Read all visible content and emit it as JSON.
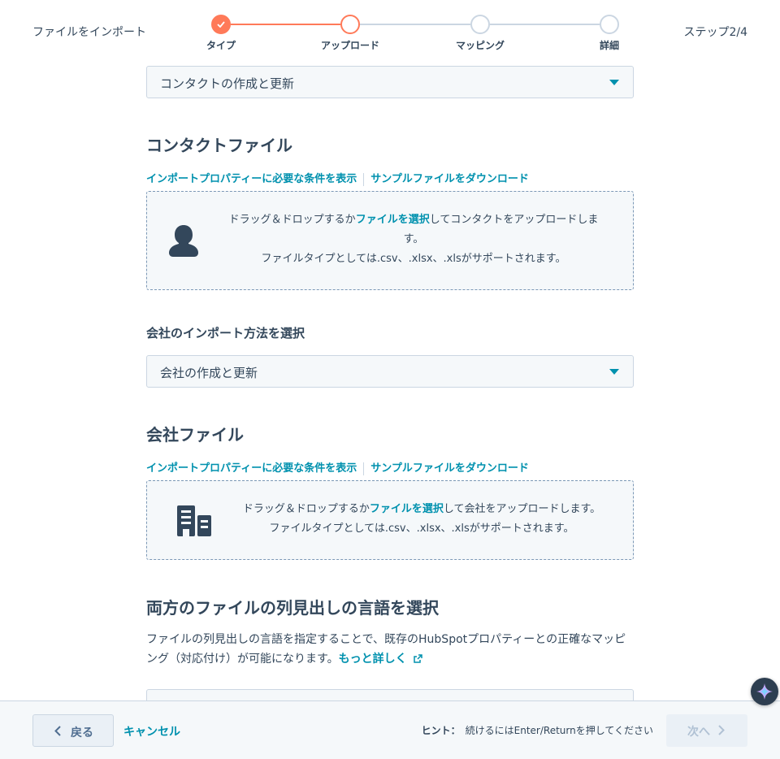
{
  "header": {
    "title": "ファイルをインポート",
    "step_counter": "ステップ2/4",
    "steps": [
      {
        "label": "タイプ",
        "state": "done"
      },
      {
        "label": "アップロード",
        "state": "current"
      },
      {
        "label": "マッピング",
        "state": "todo"
      },
      {
        "label": "詳細",
        "state": "todo"
      }
    ]
  },
  "contact_section": {
    "select_value": "コンタクトの作成と更新",
    "heading": "コンタクトファイル",
    "link_requirements": "インポートプロパティーに必要な条件を表示",
    "link_sample": "サンプルファイルをダウンロード",
    "drop_text_before": "ドラッグ＆ドロップするか",
    "drop_link": "ファイルを選択",
    "drop_text_after_line1": "してコンタクトをアップロードしま",
    "drop_text_after_line2": "す。",
    "drop_filetypes": "ファイルタイプとしては.csv、.xlsx、.xlsがサポートされます。",
    "icon": "contact-person-icon"
  },
  "company_section": {
    "method_label": "会社のインポート方法を選択",
    "select_value": "会社の作成と更新",
    "heading": "会社ファイル",
    "link_requirements": "インポートプロパティーに必要な条件を表示",
    "link_sample": "サンプルファイルをダウンロード",
    "drop_text_before": "ドラッグ＆ドロップするか",
    "drop_link": "ファイルを選択",
    "drop_text_after": "して会社をアップロードします。",
    "drop_filetypes": "ファイルタイプとしては.csv、.xlsx、.xlsがサポートされます。",
    "icon": "company-building-icon"
  },
  "language_section": {
    "heading": "両方のファイルの列見出しの言語を選択",
    "desc_line1": "ファイルの列見出しの言語を指定することで、既存のHubSpotプロパティーとの正確なマッピ",
    "desc_line2": "ング（対応付け）が可能になります。",
    "learn_more": "もっと詳しく"
  },
  "footer": {
    "back_label": "戻る",
    "cancel_label": "キャンセル",
    "hint_label": "ヒント：",
    "hint_text": "続けるにはEnter/Returnを押してください",
    "next_label": "次へ"
  },
  "colors": {
    "accent": "#ff7a59",
    "link": "#0091ae",
    "text": "#33475b",
    "border": "#cbd6e2",
    "surface": "#f5f8fa"
  }
}
